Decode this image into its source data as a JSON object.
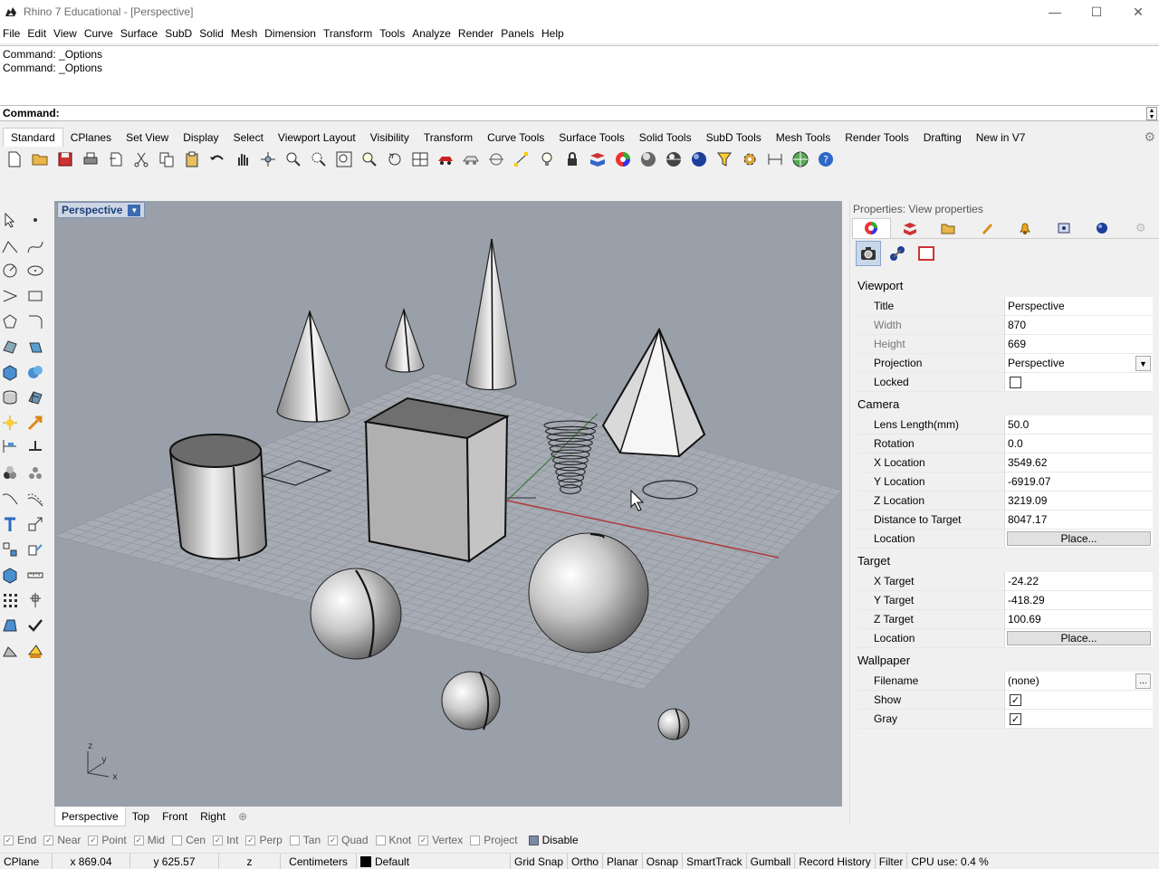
{
  "window": {
    "title": "Rhino 7 Educational - [Perspective]",
    "minimize": "—",
    "maximize": "☐",
    "close": "✕"
  },
  "menu": [
    "File",
    "Edit",
    "View",
    "Curve",
    "Surface",
    "SubD",
    "Solid",
    "Mesh",
    "Dimension",
    "Transform",
    "Tools",
    "Analyze",
    "Render",
    "Panels",
    "Help"
  ],
  "command_history": [
    "Command: _Options",
    "Command: _Options"
  ],
  "command_prompt": "Command:",
  "toolbar_tabs": [
    "Standard",
    "CPlanes",
    "Set View",
    "Display",
    "Select",
    "Viewport Layout",
    "Visibility",
    "Transform",
    "Curve Tools",
    "Surface Tools",
    "Solid Tools",
    "SubD Tools",
    "Mesh Tools",
    "Render Tools",
    "Drafting",
    "New in V7"
  ],
  "active_toolbar_tab": "Standard",
  "viewport": {
    "label": "Perspective",
    "axis_labels": {
      "z": "z",
      "y": "y",
      "x": "x"
    }
  },
  "viewport_tabs": [
    "Perspective",
    "Top",
    "Front",
    "Right"
  ],
  "properties": {
    "panel_title": "Properties: View properties",
    "sections": {
      "viewport": "Viewport",
      "camera": "Camera",
      "target": "Target",
      "wallpaper": "Wallpaper"
    },
    "rows": {
      "title": {
        "label": "Title",
        "value": "Perspective"
      },
      "width": {
        "label": "Width",
        "value": "870"
      },
      "height": {
        "label": "Height",
        "value": "669"
      },
      "projection": {
        "label": "Projection",
        "value": "Perspective"
      },
      "locked": {
        "label": "Locked"
      },
      "lens": {
        "label": "Lens Length(mm)",
        "value": "50.0"
      },
      "rotation": {
        "label": "Rotation",
        "value": "0.0"
      },
      "xloc": {
        "label": "X Location",
        "value": "3549.62"
      },
      "yloc": {
        "label": "Y Location",
        "value": "-6919.07"
      },
      "zloc": {
        "label": "Z Location",
        "value": "3219.09"
      },
      "dist": {
        "label": "Distance to Target",
        "value": "8047.17"
      },
      "cam_location": {
        "label": "Location",
        "button": "Place..."
      },
      "xtarget": {
        "label": "X Target",
        "value": "-24.22"
      },
      "ytarget": {
        "label": "Y Target",
        "value": "-418.29"
      },
      "ztarget": {
        "label": "Z Target",
        "value": "100.69"
      },
      "tgt_location": {
        "label": "Location",
        "button": "Place..."
      },
      "filename": {
        "label": "Filename",
        "value": "(none)",
        "button": "..."
      },
      "show": {
        "label": "Show"
      },
      "gray": {
        "label": "Gray"
      }
    },
    "checked": "✓"
  },
  "osnaps": [
    {
      "label": "End",
      "checked": true
    },
    {
      "label": "Near",
      "checked": true
    },
    {
      "label": "Point",
      "checked": true
    },
    {
      "label": "Mid",
      "checked": true
    },
    {
      "label": "Cen",
      "checked": false
    },
    {
      "label": "Int",
      "checked": true
    },
    {
      "label": "Perp",
      "checked": true
    },
    {
      "label": "Tan",
      "checked": false
    },
    {
      "label": "Quad",
      "checked": true
    },
    {
      "label": "Knot",
      "checked": false
    },
    {
      "label": "Vertex",
      "checked": true
    },
    {
      "label": "Project",
      "checked": false
    }
  ],
  "osnap_disable": "Disable",
  "status": {
    "cplane": "CPlane",
    "x": "x 869.04",
    "y": "y 625.57",
    "z": "z",
    "units": "Centimeters",
    "layer": "Default",
    "grid_snap": "Grid Snap",
    "ortho": "Ortho",
    "planar": "Planar",
    "osnap": "Osnap",
    "smarttrack": "SmartTrack",
    "gumball": "Gumball",
    "record_history": "Record History",
    "filter": "Filter",
    "cpu": "CPU use: 0.4 %"
  }
}
